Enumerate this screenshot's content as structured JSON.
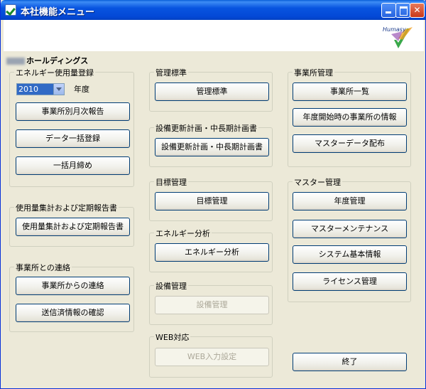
{
  "window": {
    "title": "本社機能メニュー"
  },
  "logo_text": "Humasy",
  "company": "ホールディングス",
  "energy_group": {
    "label": "エネルギー使用量登録",
    "year_select": "2010",
    "year_label": "年度",
    "buttons": [
      "事業所別月次報告",
      "データ一括登録",
      "一括月締め"
    ]
  },
  "report_group": {
    "label": "使用量集計および定期報告書",
    "button": "使用量集計および定期報告書"
  },
  "contact_group": {
    "label": "事業所との連絡",
    "buttons": [
      "事業所からの連絡",
      "送信済情報の確認"
    ]
  },
  "mgmt_std_group": {
    "label": "管理標準",
    "button": "管理標準"
  },
  "equip_plan_group": {
    "label": "設備更新計画・中長期計画書",
    "button": "設備更新計画・中長期計画書"
  },
  "target_group": {
    "label": "目標管理",
    "button": "目標管理"
  },
  "energy_analysis_group": {
    "label": "エネルギー分析",
    "button": "エネルギー分析"
  },
  "equip_mgmt_group": {
    "label": "設備管理",
    "button": "設備管理"
  },
  "web_group": {
    "label": "WEB対応",
    "button": "WEB入力設定"
  },
  "office_group": {
    "label": "事業所管理",
    "buttons": [
      "事業所一覧",
      "年度開始時の事業所の情報",
      "マスターデータ配布"
    ]
  },
  "master_group": {
    "label": "マスター管理",
    "buttons": [
      "年度管理",
      "マスターメンテナンス",
      "システム基本情報",
      "ライセンス管理"
    ]
  },
  "exit_button": "終了"
}
